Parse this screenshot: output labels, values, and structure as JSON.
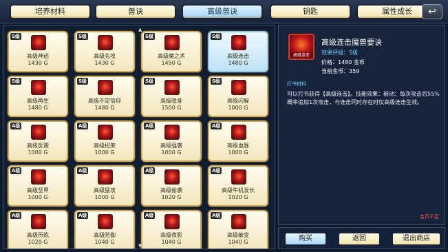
{
  "tabs": [
    {
      "label": "培养材料",
      "active": false
    },
    {
      "label": "兽诀",
      "active": false
    },
    {
      "label": "高级兽诀",
      "active": true
    },
    {
      "label": "钥匙",
      "active": false
    },
    {
      "label": "属性成长",
      "active": false
    }
  ],
  "back_icon": "return-arrow-icon",
  "items": [
    {
      "grade": "S级",
      "name": "高级神迹",
      "price": "1430 G",
      "selected": false
    },
    {
      "grade": "S级",
      "name": "高级先攻",
      "price": "1430 G",
      "selected": false
    },
    {
      "grade": "S级",
      "name": "高级魔之术",
      "price": "1450 G",
      "selected": false
    },
    {
      "grade": "S级",
      "name": "高级连击",
      "price": "1480 G",
      "selected": true
    },
    {
      "grade": "S级",
      "name": "高级再生",
      "price": "1480 G",
      "selected": false
    },
    {
      "grade": "S级",
      "name": "高级不定信仰",
      "price": "1480 G",
      "selected": false
    },
    {
      "grade": "S级",
      "name": "高级隐身",
      "price": "1500 G",
      "selected": false
    },
    {
      "grade": "S级",
      "name": "高级闪躲",
      "price": "1000 G",
      "selected": false
    },
    {
      "grade": "A级",
      "name": "高级反震",
      "price": "1000 G",
      "selected": false
    },
    {
      "grade": "A级",
      "name": "高级招架",
      "price": "1000 G",
      "selected": false
    },
    {
      "grade": "A级",
      "name": "高级强袭",
      "price": "1000 G",
      "selected": false
    },
    {
      "grade": "A级",
      "name": "高级血脉",
      "price": "1000 G",
      "selected": false
    },
    {
      "grade": "A级",
      "name": "高级坚甲",
      "price": "1000 G",
      "selected": false
    },
    {
      "grade": "A级",
      "name": "高级猛攻",
      "price": "1000 G",
      "selected": false
    },
    {
      "grade": "A级",
      "name": "高级偷袭",
      "price": "1020 G",
      "selected": false
    },
    {
      "grade": "A级",
      "name": "高级牛机发长",
      "price": "1020 G",
      "selected": false
    },
    {
      "grade": "A级",
      "name": "高级历练",
      "price": "1020 G",
      "selected": false
    },
    {
      "grade": "A级",
      "name": "高级防御",
      "price": "1040 G",
      "selected": false
    },
    {
      "grade": "A级",
      "name": "高级夜影",
      "price": "1040 G",
      "selected": false
    },
    {
      "grade": "A级",
      "name": "高级敏变",
      "price": "1040 G",
      "selected": false
    }
  ],
  "detail": {
    "icon_label": "高级连击",
    "title": "高级连击魔兽要诀",
    "grade": "效果评级：S级",
    "price": "价格：1480 金币",
    "money": "当前金币：359",
    "section": "打书材料",
    "desc": "可以打书获得【高级连击】。技能效果：被动：每次攻击后55%概率追加1次攻击，与连击同时存在时仅高级连击生效。",
    "note": "金币不足"
  },
  "buttons": {
    "buy": "购买",
    "return": "返回",
    "exit": "退出商店"
  },
  "colors": {
    "card_bg": "#f6ebc4",
    "selected_bg": "#bfe1f6",
    "panel_bg": "#16233a",
    "accent_blue": "#6ad0ff",
    "warning_red": "#ff5a5a"
  }
}
